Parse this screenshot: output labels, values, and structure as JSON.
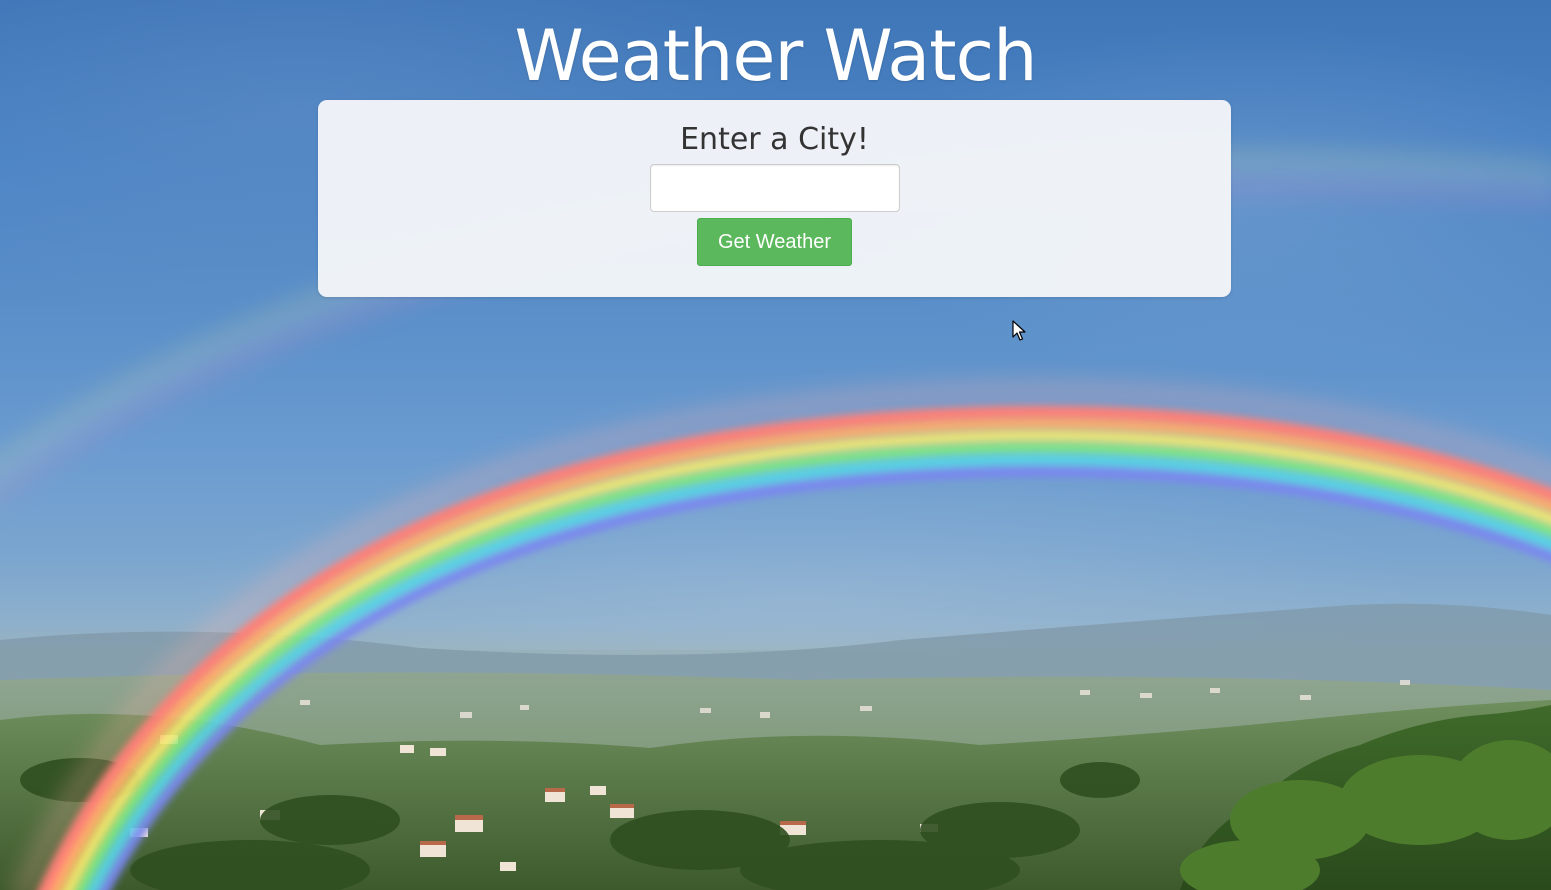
{
  "header": {
    "title": "Weather Watch"
  },
  "search_card": {
    "heading": "Enter a City!",
    "city_input": {
      "value": "",
      "placeholder": ""
    },
    "submit_label": "Get Weather"
  },
  "background": {
    "image": "rainbow-over-valley-landscape"
  },
  "colors": {
    "title_text": "#ffffff",
    "card_background": "#f3f5f8",
    "heading_text": "#333333",
    "button_background": "#5cb85c",
    "button_text": "#ffffff"
  }
}
